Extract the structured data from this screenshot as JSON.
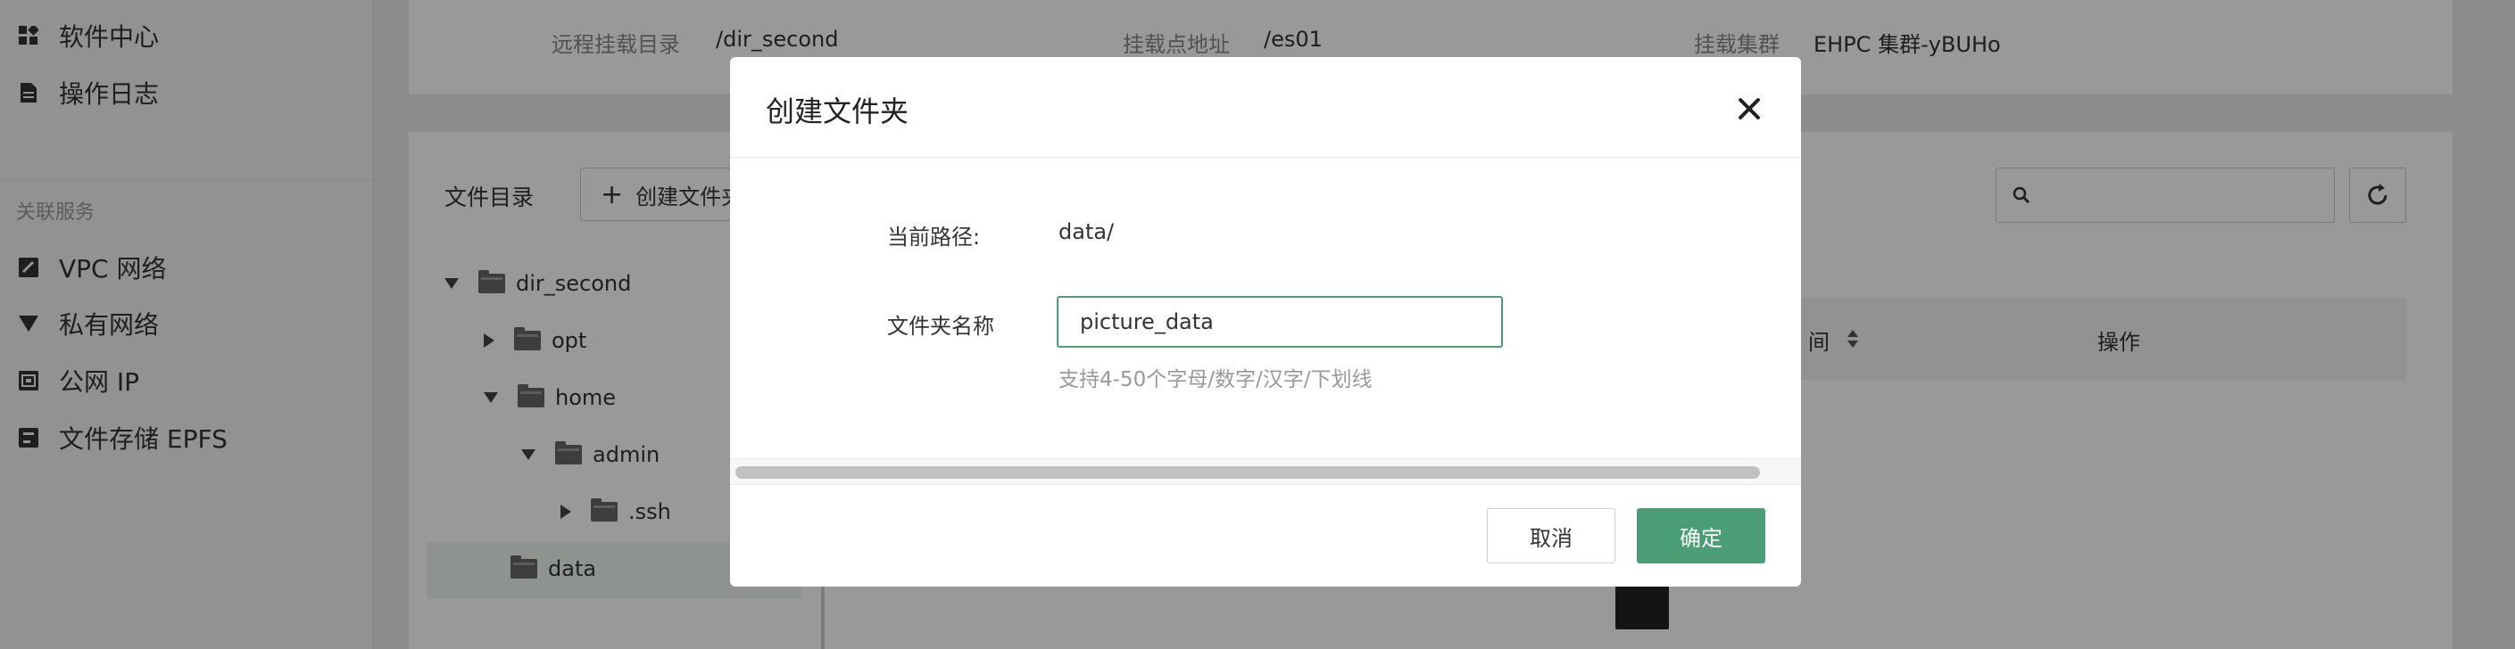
{
  "sidebar": {
    "items_top": [
      {
        "label": "软件中心",
        "icon": "grid-icon"
      },
      {
        "label": "操作日志",
        "icon": "document-icon"
      }
    ],
    "group_label": "关联服务",
    "items_related": [
      {
        "label": "VPC 网络",
        "icon": "vpc-icon"
      },
      {
        "label": "私有网络",
        "icon": "wifi-icon"
      },
      {
        "label": "公网 IP",
        "icon": "ip-icon"
      },
      {
        "label": "文件存储 EPFS",
        "icon": "storage-icon"
      }
    ]
  },
  "info": {
    "remote_dir_label": "远程挂载目录",
    "remote_dir_value": "/dir_second",
    "mount_point_label": "挂载点地址",
    "mount_point_value": "/es01",
    "cluster_label": "挂载集群",
    "cluster_value": "EHPC 集群-yBUHo"
  },
  "files": {
    "directory_label": "文件目录",
    "create_folder_label": "创建文件夹",
    "tree": [
      {
        "label": "dir_second",
        "toggle": "expanded"
      },
      {
        "label": "opt",
        "toggle": "collapsed"
      },
      {
        "label": "home",
        "toggle": "expanded"
      },
      {
        "label": "admin",
        "toggle": "expanded"
      },
      {
        "label": ".ssh",
        "toggle": "collapsed"
      },
      {
        "label": "data",
        "toggle": "none"
      }
    ],
    "table_headers": {
      "time": "间",
      "actions": "操作"
    }
  },
  "modal": {
    "title": "创建文件夹",
    "path_label": "当前路径:",
    "path_value": "data/",
    "name_label": "文件夹名称",
    "name_value": "picture_data",
    "hint": "支持4-50个字母/数字/汉字/下划线",
    "cancel_label": "取消",
    "confirm_label": "确定"
  },
  "colors": {
    "accent": "#4a9d74",
    "overlay": "rgba(0,0,0,0.4)"
  }
}
